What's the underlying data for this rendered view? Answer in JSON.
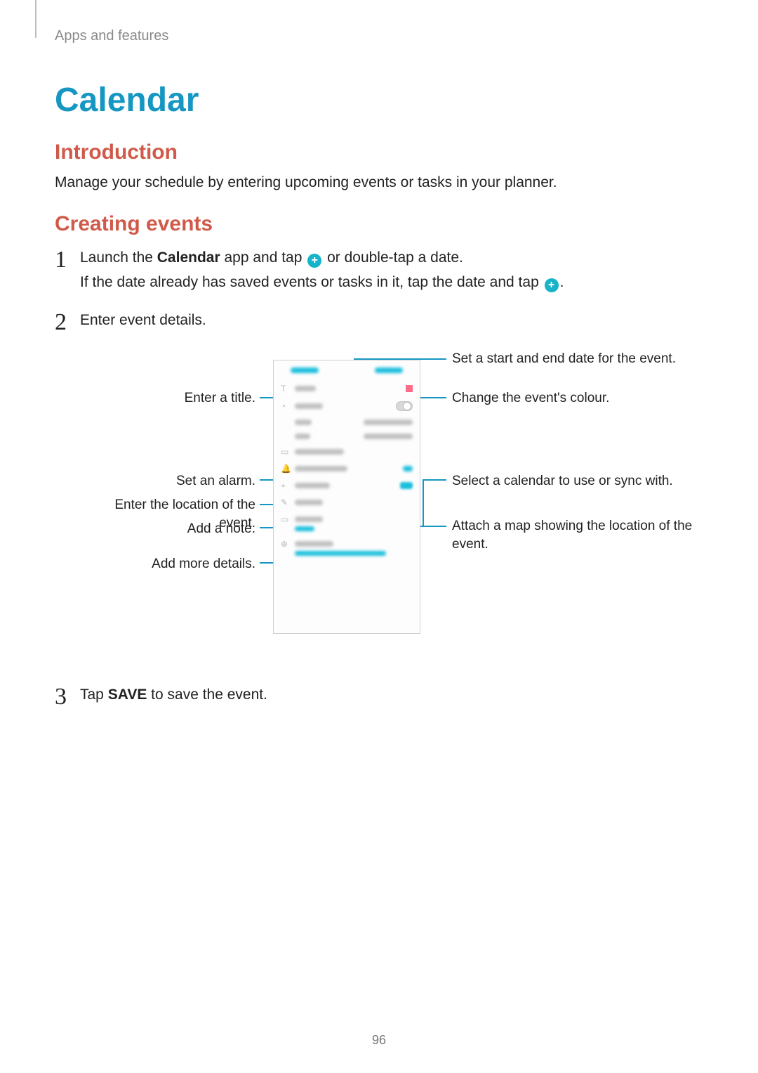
{
  "breadcrumb": "Apps and features",
  "title": "Calendar",
  "section_intro_heading": "Introduction",
  "section_intro_text": "Manage your schedule by entering upcoming events or tasks in your planner.",
  "section_create_heading": "Creating events",
  "steps": {
    "s1_pre": "Launch the ",
    "s1_bold": "Calendar",
    "s1_mid": " app and tap ",
    "s1_post": " or double-tap a date.",
    "s1_line2_pre": "If the date already has saved events or tasks in it, tap the date and tap ",
    "s1_line2_post": ".",
    "s2": "Enter event details.",
    "s3_pre": "Tap ",
    "s3_bold": "SAVE",
    "s3_post": " to save the event."
  },
  "callouts": {
    "left": {
      "title": "Enter a title.",
      "alarm": "Set an alarm.",
      "location": "Enter the location of the event.",
      "note": "Add a note.",
      "more": "Add more details."
    },
    "right": {
      "dates": "Set a start and end date for the event.",
      "colour": "Change the event's colour.",
      "calendar": "Select a calendar to use or sync with.",
      "map": "Attach a map showing the location of the event."
    }
  },
  "page_number": "96",
  "plus_glyph": "+"
}
